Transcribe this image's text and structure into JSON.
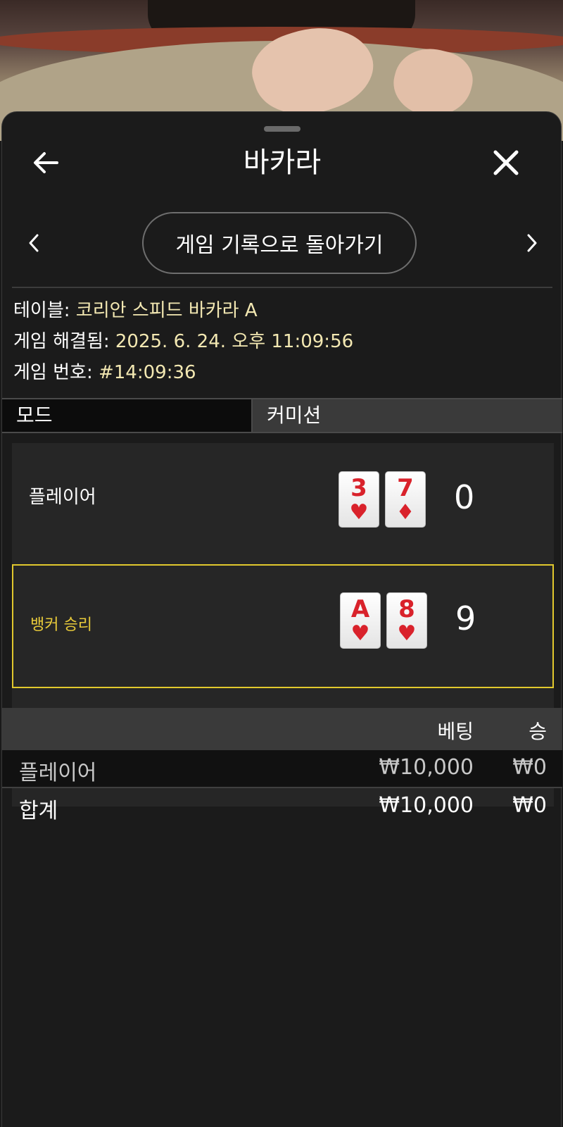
{
  "header": {
    "title": "바카라",
    "back_icon": "arrow-left-icon",
    "close_icon": "close-icon"
  },
  "nav": {
    "back_to_history": "게임 기록으로 돌아가기",
    "prev_icon": "chevron-left-icon",
    "next_icon": "chevron-right-icon"
  },
  "info": {
    "table_label": "테이블: ",
    "table_value": "코리안 스피드 바카라 A",
    "resolved_label": "게임 해결됨: ",
    "resolved_value": "2025. 6. 24. 오후 11:09:56",
    "game_no_label": "게임 번호: ",
    "game_no_value": "#14:09:36"
  },
  "tabs": {
    "mode": "모드",
    "commission": "커미션"
  },
  "results": {
    "player": {
      "label": "플레이어",
      "cards": [
        {
          "rank": "3",
          "suit": "♥"
        },
        {
          "rank": "7",
          "suit": "♦"
        }
      ],
      "score": "0"
    },
    "banker": {
      "label": "뱅커 승리",
      "cards": [
        {
          "rank": "A",
          "suit": "♥"
        },
        {
          "rank": "8",
          "suit": "♥"
        }
      ],
      "score": "9"
    }
  },
  "bets": {
    "headers": {
      "bet": "베팅",
      "win": "승"
    },
    "rows": [
      {
        "name": "플레이어",
        "bet": "₩10,000",
        "win": "₩0"
      }
    ],
    "total": {
      "name": "합계",
      "bet": "₩10,000",
      "win": "₩0"
    }
  },
  "colors": {
    "accent_yellow": "#e1c82d",
    "card_red": "#d9222b",
    "info_value": "#f3e8b2"
  }
}
